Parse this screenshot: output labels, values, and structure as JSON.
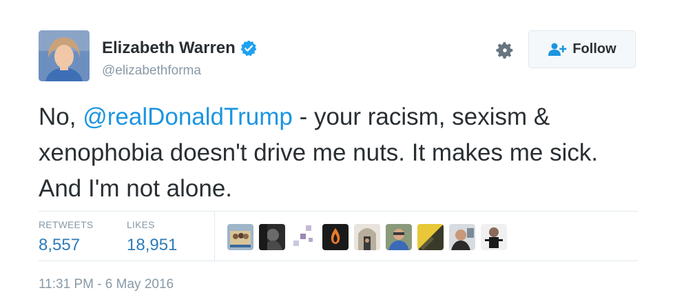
{
  "user": {
    "name": "Elizabeth Warren",
    "handle": "@elizabethforma",
    "verified": true
  },
  "follow_button": {
    "label": "Follow"
  },
  "tweet": {
    "text_before": "No, ",
    "mention": "@realDonaldTrump",
    "text_after": " - your racism, sexism & xenophobia doesn't drive me nuts. It makes me sick. And I'm not alone."
  },
  "stats": {
    "retweets_label": "RETWEETS",
    "retweets_value": "8,557",
    "likes_label": "LIKES",
    "likes_value": "18,951"
  },
  "likers": [
    {
      "name": "liker-avatar-1"
    },
    {
      "name": "liker-avatar-2"
    },
    {
      "name": "liker-avatar-3"
    },
    {
      "name": "liker-avatar-4"
    },
    {
      "name": "liker-avatar-5"
    },
    {
      "name": "liker-avatar-6"
    },
    {
      "name": "liker-avatar-7"
    },
    {
      "name": "liker-avatar-8"
    },
    {
      "name": "liker-avatar-9"
    }
  ],
  "timestamp": "11:31 PM - 6 May 2016",
  "colors": {
    "link": "#1b95e0",
    "stat_value": "#2b7bb9",
    "muted": "#8899a6",
    "verified": "#1da1f2"
  },
  "icons": [
    "verified-badge-icon",
    "gear-icon",
    "follow-user-icon"
  ]
}
